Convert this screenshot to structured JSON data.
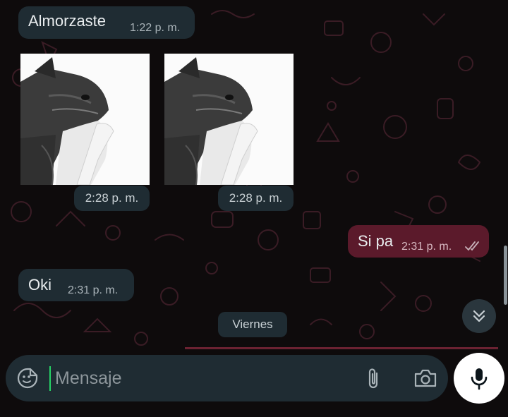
{
  "conversation": {
    "messages": [
      {
        "direction": "incoming",
        "type": "text",
        "text": "Almorzaste",
        "time": "1:22 p. m."
      },
      {
        "direction": "incoming",
        "type": "photo",
        "time": "2:28 p. m."
      },
      {
        "direction": "incoming",
        "type": "photo",
        "time": "2:28 p. m."
      },
      {
        "direction": "outgoing",
        "type": "text",
        "text": "Si pa",
        "time": "2:31 p. m.",
        "status": "read"
      },
      {
        "direction": "incoming",
        "type": "text",
        "text": "Oki",
        "time": "2:31 p. m."
      }
    ],
    "date_divider": "Viernes"
  },
  "composer": {
    "placeholder": "Mensaje",
    "value": ""
  },
  "icons": {
    "emoji": "sticker-smiley-icon",
    "attach": "paperclip-icon",
    "camera": "camera-icon",
    "send": "microphone-icon",
    "scroll": "double-chevron-down-icon",
    "read_receipt": "double-check-icon"
  },
  "colors": {
    "background": "#0e0b0c",
    "bubble_incoming": "#1f2c33",
    "bubble_outgoing": "#5b1a2b",
    "accent_caret": "#25d366",
    "read_receipt": "#c7b1b9"
  }
}
